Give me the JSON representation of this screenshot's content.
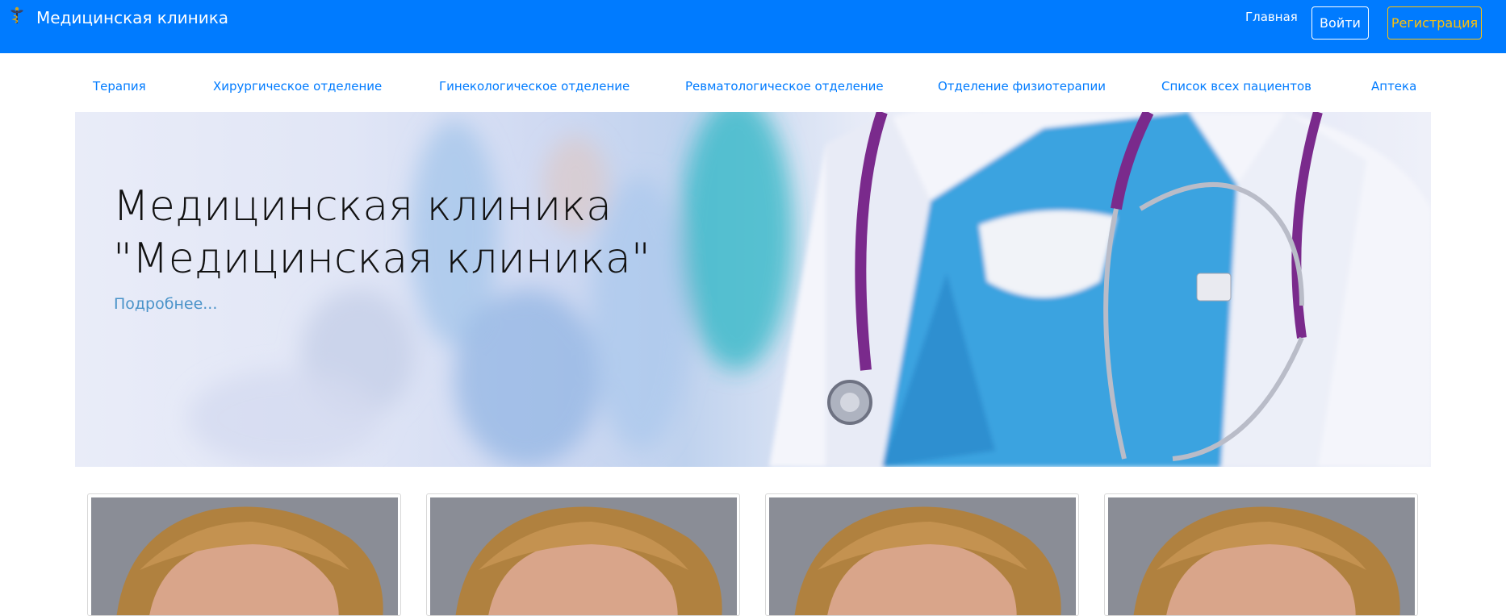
{
  "header": {
    "brand_title": "Медицинская клиника",
    "logo_icon": "caduceus-icon",
    "nav_home": "Главная",
    "login_label": "Войти",
    "register_label": "Регистрация",
    "colors": {
      "navbar": "#007bff",
      "register": "#ffc107"
    }
  },
  "departments": [
    {
      "label": "Терапия"
    },
    {
      "label": "Хирургическое отделение"
    },
    {
      "label": "Гинекологическое отделение"
    },
    {
      "label": "Ревматологическое отделение"
    },
    {
      "label": "Отделение физиотерапии"
    },
    {
      "label": "Список всех пациентов"
    },
    {
      "label": "Аптека"
    }
  ],
  "hero": {
    "title_line1": "Медицинская клиника",
    "title_line2": "\"Медицинская клиника\"",
    "more_link": "Подробнее..."
  },
  "cards": [
    {
      "photo": "doctor-photo"
    },
    {
      "photo": "doctor-photo"
    },
    {
      "photo": "doctor-photo"
    },
    {
      "photo": "doctor-photo"
    }
  ]
}
